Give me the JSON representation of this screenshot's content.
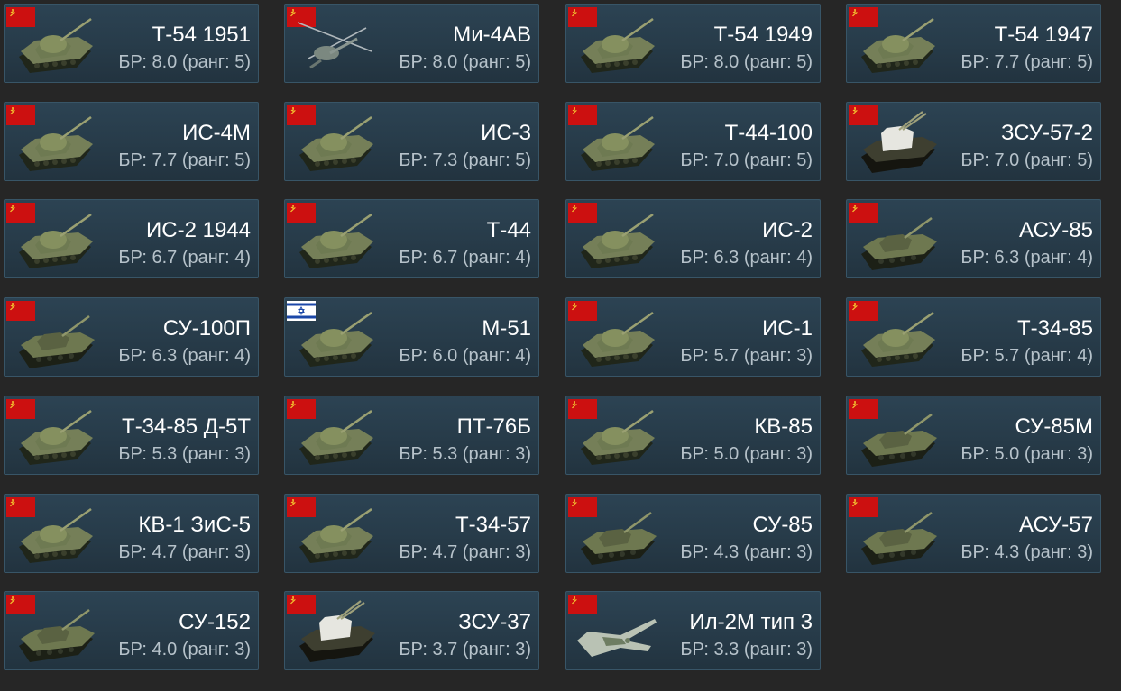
{
  "theme": {
    "background": "#262626",
    "card_background": "#2a3f4e",
    "card_border": "#385567",
    "name_color": "#ffffff",
    "br_color": "#b6c2ca",
    "ussr_flag": "#cc1010",
    "israel_flag_blue": "#1b47a8"
  },
  "vehicles": [
    {
      "name": "Т-54 1951",
      "br": "БР: 8.0 (ранг: 5)",
      "flag": "ussr-flag-icon",
      "icon": "tank-icon",
      "nation": "ussr"
    },
    {
      "name": "Ми-4АВ",
      "br": "БР: 8.0 (ранг: 5)",
      "flag": "ussr-flag-icon",
      "icon": "helicopter-icon",
      "nation": "ussr"
    },
    {
      "name": "Т-54 1949",
      "br": "БР: 8.0 (ранг: 5)",
      "flag": "ussr-flag-icon",
      "icon": "tank-icon",
      "nation": "ussr"
    },
    {
      "name": "Т-54 1947",
      "br": "БР: 7.7 (ранг: 5)",
      "flag": "ussr-flag-icon",
      "icon": "tank-icon",
      "nation": "ussr"
    },
    {
      "name": "ИС-4М",
      "br": "БР: 7.7 (ранг: 5)",
      "flag": "ussr-flag-icon",
      "icon": "tank-icon",
      "nation": "ussr"
    },
    {
      "name": "ИС-3",
      "br": "БР: 7.3 (ранг: 5)",
      "flag": "ussr-flag-icon",
      "icon": "tank-icon",
      "nation": "ussr"
    },
    {
      "name": "Т-44-100",
      "br": "БР: 7.0 (ранг: 5)",
      "flag": "ussr-flag-icon",
      "icon": "tank-icon",
      "nation": "ussr"
    },
    {
      "name": "ЗСУ-57-2",
      "br": "БР: 7.0 (ранг: 5)",
      "flag": "ussr-flag-icon",
      "icon": "spaa-icon",
      "nation": "ussr"
    },
    {
      "name": "ИС-2 1944",
      "br": "БР: 6.7 (ранг: 4)",
      "flag": "ussr-flag-icon",
      "icon": "tank-icon",
      "nation": "ussr"
    },
    {
      "name": "Т-44",
      "br": "БР: 6.7 (ранг: 4)",
      "flag": "ussr-flag-icon",
      "icon": "tank-icon",
      "nation": "ussr"
    },
    {
      "name": "ИС-2",
      "br": "БР: 6.3 (ранг: 4)",
      "flag": "ussr-flag-icon",
      "icon": "tank-icon",
      "nation": "ussr"
    },
    {
      "name": "АСУ-85",
      "br": "БР: 6.3 (ранг: 4)",
      "flag": "ussr-flag-icon",
      "icon": "tank-destroyer-icon",
      "nation": "ussr"
    },
    {
      "name": "СУ-100П",
      "br": "БР: 6.3 (ранг: 4)",
      "flag": "ussr-flag-icon",
      "icon": "tank-destroyer-icon",
      "nation": "ussr"
    },
    {
      "name": "М-51",
      "br": "БР: 6.0 (ранг: 4)",
      "flag": "israel-flag-icon",
      "icon": "tank-icon",
      "nation": "israel"
    },
    {
      "name": "ИС-1",
      "br": "БР: 5.7 (ранг: 3)",
      "flag": "ussr-flag-icon",
      "icon": "tank-icon",
      "nation": "ussr"
    },
    {
      "name": "Т-34-85",
      "br": "БР: 5.7 (ранг: 4)",
      "flag": "ussr-flag-icon",
      "icon": "tank-icon",
      "nation": "ussr"
    },
    {
      "name": "Т-34-85 Д-5Т",
      "br": "БР: 5.3 (ранг: 3)",
      "flag": "ussr-flag-icon",
      "icon": "tank-icon",
      "nation": "ussr"
    },
    {
      "name": "ПТ-76Б",
      "br": "БР: 5.3 (ранг: 3)",
      "flag": "ussr-flag-icon",
      "icon": "tank-icon",
      "nation": "ussr"
    },
    {
      "name": "КВ-85",
      "br": "БР: 5.0 (ранг: 3)",
      "flag": "ussr-flag-icon",
      "icon": "tank-icon",
      "nation": "ussr"
    },
    {
      "name": "СУ-85М",
      "br": "БР: 5.0 (ранг: 3)",
      "flag": "ussr-flag-icon",
      "icon": "tank-destroyer-icon",
      "nation": "ussr"
    },
    {
      "name": "КВ-1 ЗиС-5",
      "br": "БР: 4.7 (ранг: 3)",
      "flag": "ussr-flag-icon",
      "icon": "tank-icon",
      "nation": "ussr"
    },
    {
      "name": "Т-34-57",
      "br": "БР: 4.7 (ранг: 3)",
      "flag": "ussr-flag-icon",
      "icon": "tank-icon",
      "nation": "ussr"
    },
    {
      "name": "СУ-85",
      "br": "БР: 4.3 (ранг: 3)",
      "flag": "ussr-flag-icon",
      "icon": "tank-destroyer-icon",
      "nation": "ussr"
    },
    {
      "name": "АСУ-57",
      "br": "БР: 4.3 (ранг: 3)",
      "flag": "ussr-flag-icon",
      "icon": "tank-destroyer-icon",
      "nation": "ussr"
    },
    {
      "name": "СУ-152",
      "br": "БР: 4.0 (ранг: 3)",
      "flag": "ussr-flag-icon",
      "icon": "tank-destroyer-icon",
      "nation": "ussr"
    },
    {
      "name": "ЗСУ-37",
      "br": "БР: 3.7 (ранг: 3)",
      "flag": "ussr-flag-icon",
      "icon": "spaa-icon",
      "nation": "ussr"
    },
    {
      "name": "Ил-2М тип 3",
      "br": "БР: 3.3 (ранг: 3)",
      "flag": "ussr-flag-icon",
      "icon": "aircraft-icon",
      "nation": "ussr"
    }
  ]
}
